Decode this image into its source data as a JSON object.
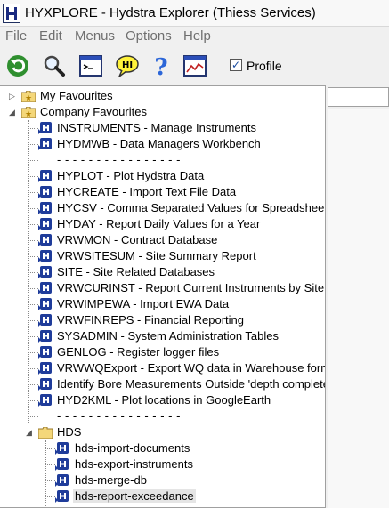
{
  "window": {
    "title": "HYXPLORE - Hydstra Explorer (Thiess Services)"
  },
  "menu": [
    "File",
    "Edit",
    "Menus",
    "Options",
    "Help"
  ],
  "toolbar": {
    "buttons": [
      "refresh-icon",
      "search-icon",
      "console-icon",
      "chat-icon",
      "help-icon",
      "chart-window-icon"
    ],
    "profile_label": "Profile",
    "profile_checked": true
  },
  "tree": {
    "my_favourites": "My Favourites",
    "company_favourites": "Company Favourites",
    "company_items": [
      "INSTRUMENTS - Manage Instruments",
      "HYDMWB - Data Managers Workbench",
      "- - - - - - - - - - - - - - - -",
      "HYPLOT - Plot Hydstra Data",
      "HYCREATE - Import Text File Data",
      "HYCSV - Comma Separated Values for Spreadsheets",
      "HYDAY - Report Daily Values for a Year",
      "VRWMON - Contract Database",
      "VRWSITESUM - Site Summary Report",
      "SITE - Site Related Databases",
      "VRWCURINST - Report Current Instruments by Site",
      "VRWIMPEWA - Import EWA Data",
      "VRWFINREPS - Financial Reporting",
      "SYSADMIN - System Administration Tables",
      "GENLOG - Register logger files",
      "VRWWQExport - Export WQ data in Warehouse format",
      "Identify Bore Measurements Outside 'depth complete'",
      "HYD2KML - Plot locations in GoogleEarth",
      "- - - - - - - - - - - - - - - -"
    ],
    "hds_folder": "HDS",
    "hds_items": [
      "hds-import-documents",
      "hds-export-instruments",
      "hds-merge-db",
      "hds-report-exceedance"
    ]
  },
  "colors": {
    "selected": "#e5e5e5",
    "icon_blue": "#1f3c9a"
  }
}
